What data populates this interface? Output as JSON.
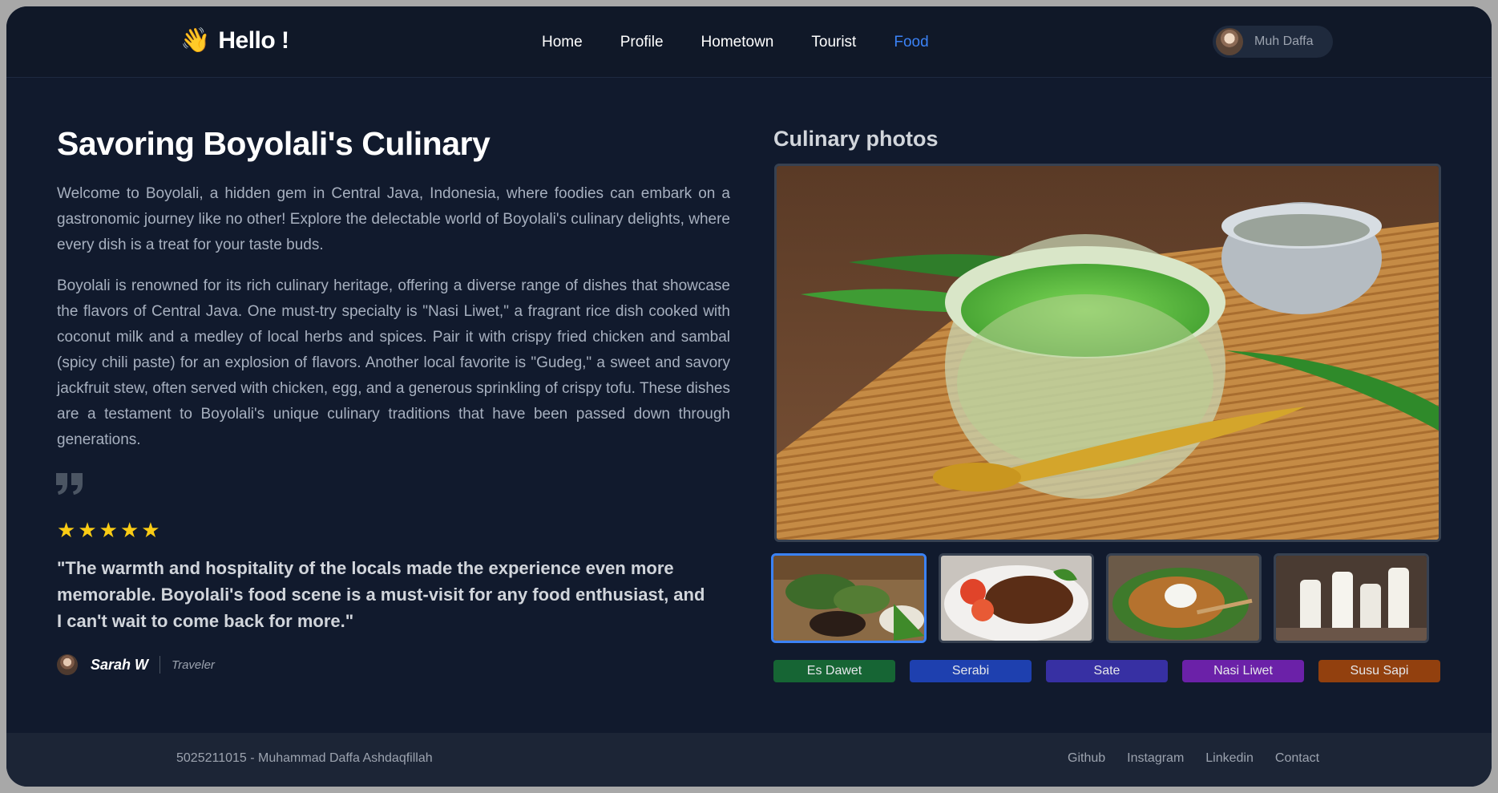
{
  "navbar": {
    "brand_icon": "waving-hand-icon",
    "brand_emoji": "👋",
    "brand_text": "Hello !",
    "links": [
      {
        "label": "Home",
        "active": false
      },
      {
        "label": "Profile",
        "active": false
      },
      {
        "label": "Hometown",
        "active": false
      },
      {
        "label": "Tourist",
        "active": false
      },
      {
        "label": "Food",
        "active": true
      }
    ],
    "user_name": "Muh Daffa"
  },
  "article": {
    "title": "Savoring Boyolali's Culinary",
    "paragraph_1": "Welcome to Boyolali, a hidden gem in Central Java, Indonesia, where foodies can embark on a gastronomic journey like no other! Explore the delectable world of Boyolali's culinary delights, where every dish is a treat for your taste buds.",
    "paragraph_2": "Boyolali is renowned for its rich culinary heritage, offering a diverse range of dishes that showcase the flavors of Central Java. One must-try specialty is \"Nasi Liwet,\" a fragrant rice dish cooked with coconut milk and a medley of local herbs and spices. Pair it with crispy fried chicken and sambal (spicy chili paste) for an explosion of flavors. Another local favorite is \"Gudeg,\" a sweet and savory jackfruit stew, often served with chicken, egg, and a generous sprinkling of crispy tofu. These dishes are a testament to Boyolali's unique culinary traditions that have been passed down through generations."
  },
  "review": {
    "rating": 5,
    "max_rating": 5,
    "star_glyph": "★",
    "quote": "\"The warmth and hospitality of the locals made the experience even more memorable. Boyolali's food scene is a must-visit for any food enthusiast, and I can't wait to come back for more.\"",
    "reviewer_name": "Sarah W",
    "reviewer_role": "Traveler"
  },
  "gallery": {
    "title": "Culinary photos",
    "selected_index": 0,
    "tags": [
      {
        "label": "Es Dawet",
        "color": "#166534"
      },
      {
        "label": "Serabi",
        "color": "#1e40af"
      },
      {
        "label": "Sate",
        "color": "#3730a3"
      },
      {
        "label": "Nasi Liwet",
        "color": "#6b21a8"
      },
      {
        "label": "Susu Sapi",
        "color": "#92400e"
      }
    ]
  },
  "footer": {
    "credit": "5025211015 - Muhammad Daffa Ashdaqfillah",
    "links": [
      "Github",
      "Instagram",
      "Linkedin",
      "Contact"
    ]
  }
}
